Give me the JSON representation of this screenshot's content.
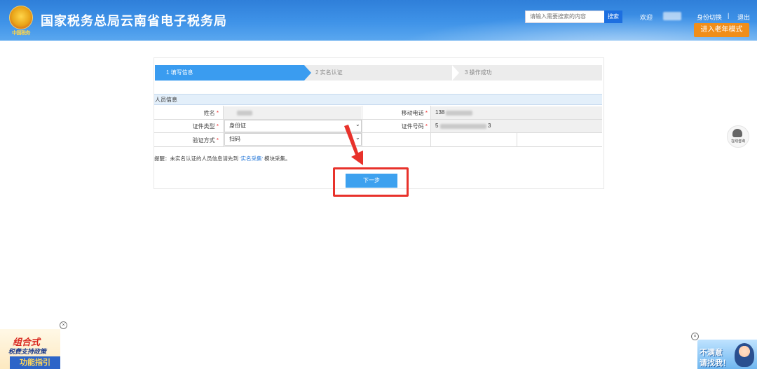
{
  "header": {
    "emblem_text": "中国税务",
    "site_title": "国家税务总局云南省电子税务局",
    "search_placeholder": "请输入需要搜索的内容",
    "search_button": "搜索",
    "welcome": "欢迎",
    "switch_identity": "身份切换",
    "separator": "|",
    "logout": "退出",
    "elder_mode": "进入老年模式"
  },
  "steps": [
    {
      "label": "1  填写信息",
      "active": true
    },
    {
      "label": "2  实名认证",
      "active": false
    },
    {
      "label": "3  操作成功",
      "active": false
    }
  ],
  "form": {
    "section_title": "人员信息",
    "name_label": "姓名",
    "mobile_label": "移动电话",
    "mobile_value_prefix": "138",
    "id_type_label": "证件类型",
    "id_type_value": "身份证",
    "id_number_label": "证件号码",
    "id_number_prefix": "5",
    "id_number_suffix": "3",
    "verify_method_label": "验证方式",
    "verify_method_value": "扫码",
    "required_mark": "*",
    "chevron": "⌄"
  },
  "hint": {
    "prefix": "提醒：未实名认证的人员信息请先到 ",
    "link": "'实名采集'",
    "suffix": " 模块采集。"
  },
  "next_button": "下一步",
  "service": {
    "label": "在线咨询"
  },
  "ad_left": {
    "line1": "组合式",
    "line2": "税费支持政策",
    "line3": "功能指引",
    "close": "×"
  },
  "ad_right": {
    "line1": "不满意",
    "line2": "请找我！",
    "close": "×"
  },
  "colors": {
    "header_blue": "#3f93e8",
    "step_active": "#3a9cf0",
    "button_blue": "#3da1ef",
    "elder_orange": "#f08e1a",
    "highlight_red": "#e8322b",
    "link_blue": "#2b7bd9"
  }
}
